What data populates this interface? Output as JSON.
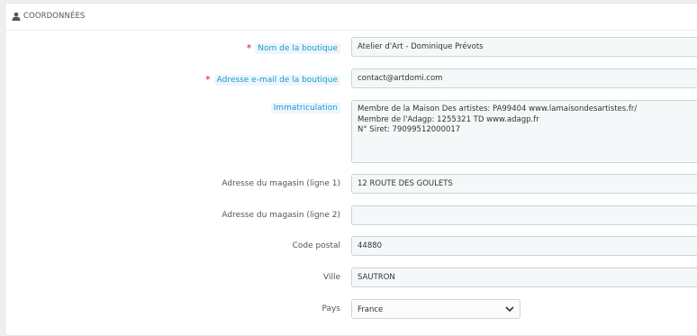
{
  "panel": {
    "title": "COORDONNÉES"
  },
  "form": {
    "shop_name": {
      "label": "Nom de la boutique",
      "required_mark": "*",
      "value": "Atelier d'Art - Dominique Prévots"
    },
    "shop_email": {
      "label": "Adresse e-mail de la boutique",
      "required_mark": "*",
      "value": "contact@artdomi.com"
    },
    "registration": {
      "label": "Immatriculation",
      "value": "Membre de la Maison Des artistes: PA99404 www.lamaisondesartistes.fr/\nMembre de l'Adagp: 1255321 TD www.adagp.fr\nN° Siret: 79099512000017"
    },
    "address1": {
      "label": "Adresse du magasin (ligne 1)",
      "value": "12 ROUTE DES GOULETS"
    },
    "address2": {
      "label": "Adresse du magasin (ligne 2)",
      "value": ""
    },
    "postcode": {
      "label": "Code postal",
      "value": "44880"
    },
    "city": {
      "label": "Ville",
      "value": "SAUTRON"
    },
    "country": {
      "label": "Pays",
      "value": "France"
    }
  },
  "icons": {
    "heading": "user-icon",
    "select": "chevron-down-icon"
  },
  "colors": {
    "required": "#e30e14",
    "link_label": "#1a9ad6",
    "field_border": "#c7d6db"
  }
}
